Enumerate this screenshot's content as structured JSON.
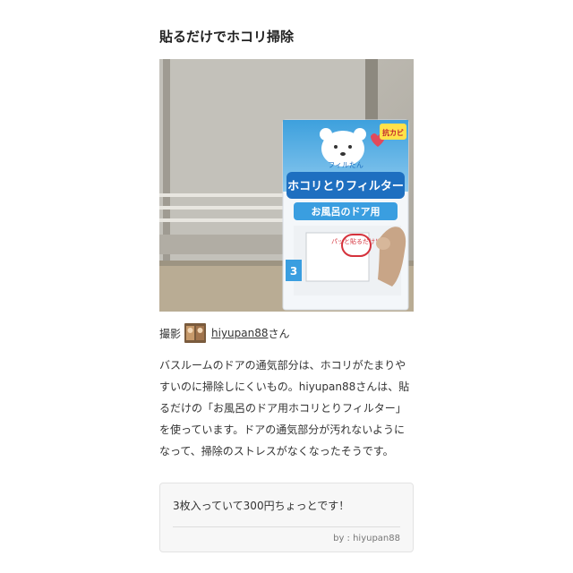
{
  "article": {
    "heading": "貼るだけでホコリ掃除",
    "photo": {
      "product": {
        "series": "フィルたん",
        "title": "ホコリとりフィルター",
        "subtitle": "お風呂のドア用",
        "badge": "抗カビ",
        "count": "3",
        "tagline": "パッと貼るだけ！"
      }
    },
    "credit": {
      "label": "撮影",
      "username": "hiyupan88",
      "suffix": "さん"
    },
    "body": "バスルームのドアの通気部分は、ホコリがたまりやすいのに掃除しにくいもの。hiyupan88さんは、貼るだけの「お風呂のドア用ホコリとりフィルター」を使っています。ドアの通気部分が汚れないようになって、掃除のストレスがなくなったそうです。",
    "quote": {
      "text": "3枚入っていて300円ちょっとです！",
      "by": "by : hiyupan88"
    }
  }
}
